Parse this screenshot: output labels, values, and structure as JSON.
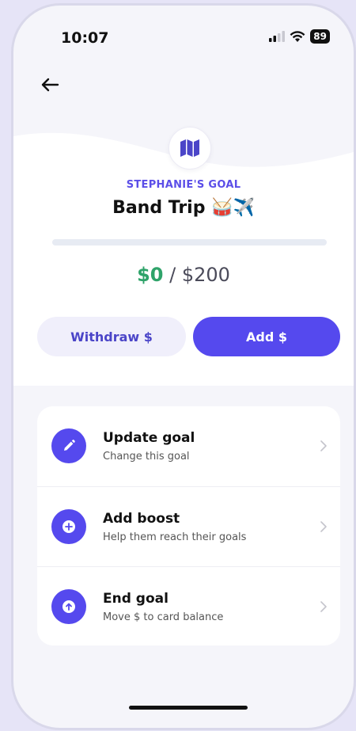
{
  "status_bar": {
    "time": "10:07",
    "battery": "89"
  },
  "goal": {
    "owner_label": "STEPHANIE'S GOAL",
    "title": "Band Trip 🥁✈️",
    "saved": "$0",
    "separator": " / ",
    "target": "$200",
    "progress_fraction": 0,
    "icon": "map-icon"
  },
  "actions": {
    "withdraw_label": "Withdraw $",
    "add_label": "Add $"
  },
  "menu": {
    "items": [
      {
        "title": "Update goal",
        "subtitle": "Change this goal",
        "icon": "pencil-icon"
      },
      {
        "title": "Add boost",
        "subtitle": "Help them reach their goals",
        "icon": "plus-circle-icon"
      },
      {
        "title": "End goal",
        "subtitle": "Move $ to card balance",
        "icon": "arrow-up-circle-icon"
      }
    ]
  },
  "colors": {
    "accent": "#5549ee",
    "saved_green": "#2fa36a",
    "background": "#f5f5fa"
  }
}
